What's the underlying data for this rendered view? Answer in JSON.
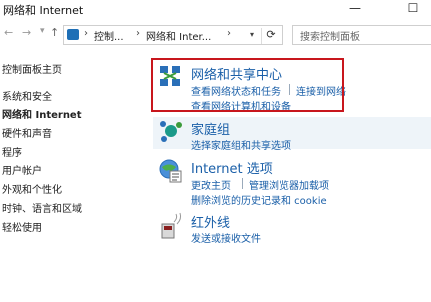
{
  "window": {
    "title": "网络和 Internet",
    "min_glyph": "—",
    "max_glyph": "☐"
  },
  "nav": {
    "back_glyph": "←",
    "forward_glyph": "→",
    "up_glyph": "↑",
    "breadcrumbs": [
      "控制...",
      "网络和 Inter..."
    ],
    "separator": "›",
    "refresh_glyph": "⟳",
    "search_placeholder": "搜索控制面板"
  },
  "sidebar": {
    "items": [
      {
        "label": "控制面板主页"
      },
      {
        "label": "系统和安全"
      },
      {
        "label": "网络和 Internet",
        "active": true
      },
      {
        "label": "硬件和声音"
      },
      {
        "label": "程序"
      },
      {
        "label": "用户帐户"
      },
      {
        "label": "外观和个性化"
      },
      {
        "label": "时钟、语言和区域"
      },
      {
        "label": "轻松使用"
      }
    ]
  },
  "categories": [
    {
      "title": "网络和共享中心",
      "icon": "network-sharing-icon",
      "links": [
        "查看网络状态和任务",
        "连接到网络",
        "查看网络计算机和设备"
      ]
    },
    {
      "title": "家庭组",
      "icon": "homegroup-icon",
      "links": [
        "选择家庭组和共享选项"
      ]
    },
    {
      "title": "Internet 选项",
      "icon": "internet-options-icon",
      "links": [
        "更改主页",
        "管理浏览器加载项",
        "删除浏览的历史记录和 cookie"
      ]
    },
    {
      "title": "红外线",
      "icon": "infrared-icon",
      "links": [
        "发送或接收文件"
      ]
    }
  ],
  "colors": {
    "link": "#1a5fa8",
    "highlight_border": "#c8161d",
    "selected_band": "#eef4f9"
  }
}
